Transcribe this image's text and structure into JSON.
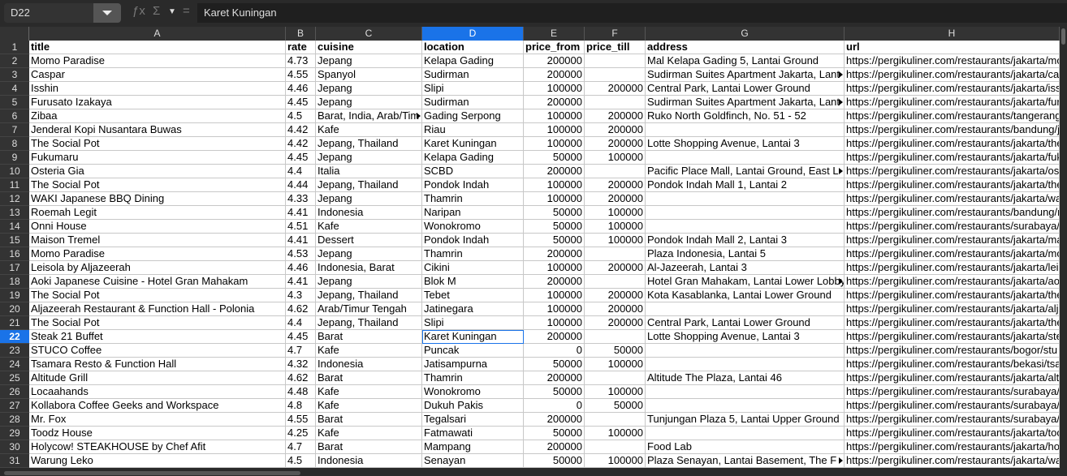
{
  "toolbar": {
    "cell_ref": "D22",
    "formula_value": "Karet Kuningan",
    "fx_icon": "ƒx",
    "sum_icon": "Σ",
    "equals_icon": "="
  },
  "columns": [
    "A",
    "B",
    "C",
    "D",
    "E",
    "F",
    "G",
    "H"
  ],
  "selected_column": "D",
  "selected_row": 22,
  "header_row": [
    "title",
    "rate",
    "cuisine",
    "location",
    "price_from",
    "price_till",
    "address",
    "url"
  ],
  "rows": [
    [
      "Momo Paradise",
      "4.73",
      "Jepang",
      "Kelapa Gading",
      "200000",
      "",
      "Mal Kelapa Gading 5, Lantai Ground",
      "https://pergikuliner.com/restaurants/jakarta/mo"
    ],
    [
      "Caspar",
      "4.55",
      "Spanyol",
      "Sudirman",
      "200000",
      "",
      "Sudirman Suites Apartment Jakarta, Lant",
      "https://pergikuliner.com/restaurants/jakarta/ca"
    ],
    [
      "Isshin",
      "4.46",
      "Jepang",
      "Slipi",
      "100000",
      "200000",
      "Central Park, Lantai Lower Ground",
      "https://pergikuliner.com/restaurants/jakarta/iss"
    ],
    [
      "Furusato Izakaya",
      "4.45",
      "Jepang",
      "Sudirman",
      "200000",
      "",
      "Sudirman Suites Apartment Jakarta, Lant",
      "https://pergikuliner.com/restaurants/jakarta/fur"
    ],
    [
      "Zibaa",
      "4.5",
      "Barat, India, Arab/Tim",
      "Gading Serpong",
      "100000",
      "200000",
      "Ruko North Goldfinch, No. 51 - 52",
      "https://pergikuliner.com/restaurants/tangerang/"
    ],
    [
      "Jenderal Kopi Nusantara Buwas",
      "4.42",
      "Kafe",
      "Riau",
      "100000",
      "200000",
      "",
      "https://pergikuliner.com/restaurants/bandung/je"
    ],
    [
      "The Social Pot",
      "4.42",
      "Jepang, Thailand",
      "Karet Kuningan",
      "100000",
      "200000",
      "Lotte Shopping Avenue, Lantai 3",
      "https://pergikuliner.com/restaurants/jakarta/the"
    ],
    [
      "Fukumaru",
      "4.45",
      "Jepang",
      "Kelapa Gading",
      "50000",
      "100000",
      "",
      "https://pergikuliner.com/restaurants/jakarta/fuk"
    ],
    [
      "Osteria Gia",
      "4.4",
      "Italia",
      "SCBD",
      "200000",
      "",
      "Pacific Place Mall, Lantai Ground, East L",
      "https://pergikuliner.com/restaurants/jakarta/os"
    ],
    [
      "The Social Pot",
      "4.44",
      "Jepang, Thailand",
      "Pondok Indah",
      "100000",
      "200000",
      "Pondok Indah Mall 1, Lantai 2",
      "https://pergikuliner.com/restaurants/jakarta/the"
    ],
    [
      "WAKI Japanese BBQ Dining",
      "4.33",
      "Jepang",
      "Thamrin",
      "100000",
      "200000",
      "",
      "https://pergikuliner.com/restaurants/jakarta/wa"
    ],
    [
      "Roemah Legit",
      "4.41",
      "Indonesia",
      "Naripan",
      "50000",
      "100000",
      "",
      "https://pergikuliner.com/restaurants/bandung/r"
    ],
    [
      "Onni House",
      "4.51",
      "Kafe",
      "Wonokromo",
      "50000",
      "100000",
      "",
      "https://pergikuliner.com/restaurants/surabaya/"
    ],
    [
      "Maison Tremel",
      "4.41",
      "Dessert",
      "Pondok Indah",
      "50000",
      "100000",
      "Pondok Indah Mall 2, Lantai 3",
      "https://pergikuliner.com/restaurants/jakarta/ma"
    ],
    [
      "Momo Paradise",
      "4.53",
      "Jepang",
      "Thamrin",
      "200000",
      "",
      "Plaza Indonesia, Lantai 5",
      "https://pergikuliner.com/restaurants/jakarta/mo"
    ],
    [
      "Leisola by Aljazeerah",
      "4.46",
      "Indonesia, Barat",
      "Cikini",
      "100000",
      "200000",
      "Al-Jazeerah, Lantai 3",
      "https://pergikuliner.com/restaurants/jakarta/lei"
    ],
    [
      "Aoki Japanese Cuisine - Hotel Gran Mahakam",
      "4.41",
      "Jepang",
      "Blok M",
      "200000",
      "",
      "Hotel Gran Mahakam, Lantai Lower Lobby",
      "https://pergikuliner.com/restaurants/jakarta/ao"
    ],
    [
      "The Social Pot",
      "4.3",
      "Jepang, Thailand",
      "Tebet",
      "100000",
      "200000",
      "Kota Kasablanka, Lantai Lower Ground",
      "https://pergikuliner.com/restaurants/jakarta/the"
    ],
    [
      "Aljazeerah Restaurant & Function Hall - Polonia",
      "4.62",
      "Arab/Timur Tengah",
      "Jatinegara",
      "100000",
      "200000",
      "",
      "https://pergikuliner.com/restaurants/jakarta/alj"
    ],
    [
      "The Social Pot",
      "4.4",
      "Jepang, Thailand",
      "Slipi",
      "100000",
      "200000",
      "Central Park, Lantai Lower Ground",
      "https://pergikuliner.com/restaurants/jakarta/the"
    ],
    [
      "Steak 21 Buffet",
      "4.45",
      "Barat",
      "Karet Kuningan",
      "200000",
      "",
      "Lotte Shopping Avenue, Lantai 3",
      "https://pergikuliner.com/restaurants/jakarta/ste"
    ],
    [
      "STUCO Coffee",
      "4.7",
      "Kafe",
      "Puncak",
      "0",
      "50000",
      "",
      "https://pergikuliner.com/restaurants/bogor/stu"
    ],
    [
      "Tsamara Resto & Function Hall",
      "4.32",
      "Indonesia",
      "Jatisampurna",
      "50000",
      "100000",
      "",
      "https://pergikuliner.com/restaurants/bekasi/tsa"
    ],
    [
      "Altitude Grill",
      "4.62",
      "Barat",
      "Thamrin",
      "200000",
      "",
      "Altitude The Plaza, Lantai 46",
      "https://pergikuliner.com/restaurants/jakarta/alt"
    ],
    [
      "Locaahands",
      "4.48",
      "Kafe",
      "Wonokromo",
      "50000",
      "100000",
      "",
      "https://pergikuliner.com/restaurants/surabaya/"
    ],
    [
      "Kollabora Coffee Geeks and Workspace",
      "4.8",
      "Kafe",
      "Dukuh Pakis",
      "0",
      "50000",
      "",
      "https://pergikuliner.com/restaurants/surabaya/"
    ],
    [
      "Mr. Fox",
      "4.55",
      "Barat",
      "Tegalsari",
      "200000",
      "",
      "Tunjungan Plaza 5, Lantai Upper Ground",
      "https://pergikuliner.com/restaurants/surabaya/"
    ],
    [
      "Toodz House",
      "4.25",
      "Kafe",
      "Fatmawati",
      "50000",
      "100000",
      "",
      "https://pergikuliner.com/restaurants/jakarta/too"
    ],
    [
      "Holycow! STEAKHOUSE by Chef Afit",
      "4.7",
      "Barat",
      "Mampang",
      "200000",
      "",
      "Food Lab",
      "https://pergikuliner.com/restaurants/jakarta/ho"
    ],
    [
      "Warung Leko",
      "4.5",
      "Indonesia",
      "Senayan",
      "50000",
      "100000",
      "Plaza Senayan, Lantai Basement, The F",
      "https://pergikuliner.com/restaurants/jakarta/wa"
    ]
  ]
}
